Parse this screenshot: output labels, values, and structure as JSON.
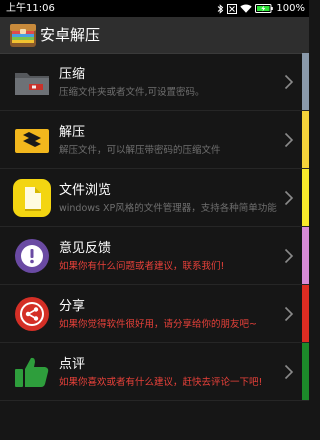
{
  "status_bar": {
    "time": "上午11:06",
    "battery": "100%"
  },
  "app": {
    "title": "安卓解压"
  },
  "items": [
    {
      "label": "压缩",
      "desc": "压缩文件夹或者文件,可设置密码。",
      "color": "#8a9aab",
      "icon": "folder-archive-icon"
    },
    {
      "label": "解压",
      "desc": "解压文件，可以解压带密码的压缩文件",
      "color": "#f4d23a",
      "icon": "unzip-box-icon"
    },
    {
      "label": "文件浏览",
      "desc": "windows XP风格的文件管理器，支持各种简单功能",
      "color": "#f9ea2b",
      "icon": "file-browser-icon"
    },
    {
      "label": "意见反馈",
      "desc": "如果你有什么问题或者建议，联系我们!",
      "color": "#d78ad6",
      "icon": "feedback-icon"
    },
    {
      "label": "分享",
      "desc": "如果你觉得软件很好用，请分享给你的朋友吧~",
      "color": "#dd2c22",
      "icon": "share-icon"
    },
    {
      "label": "点评",
      "desc": "如果你喜欢或者有什么建议，赶快去评论一下吧!",
      "color": "#1c8a2a",
      "icon": "thumbs-up-icon"
    }
  ]
}
